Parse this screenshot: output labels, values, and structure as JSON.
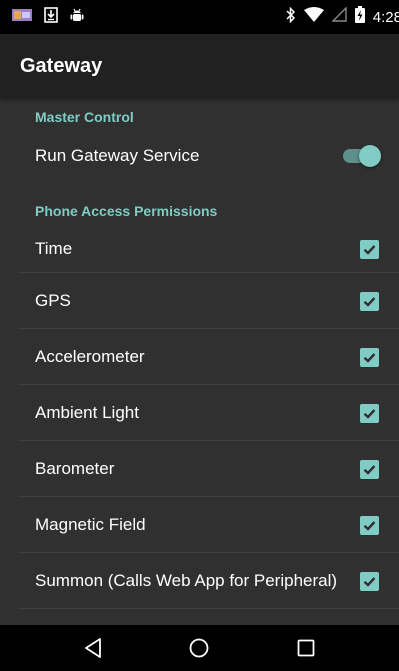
{
  "status_bar": {
    "time": "4:28",
    "icons": [
      "picture-notification-icon",
      "download-icon",
      "android-debug-icon",
      "bluetooth-icon",
      "wifi-icon",
      "signal-icon",
      "battery-charging-icon"
    ]
  },
  "app_bar": {
    "title": "Gateway"
  },
  "master_control": {
    "header": "Master Control",
    "run_service_label": "Run Gateway Service",
    "run_service_on": true
  },
  "permissions": {
    "header": "Phone Access Permissions",
    "items": [
      {
        "label": "Time",
        "checked": true
      },
      {
        "label": "GPS",
        "checked": true
      },
      {
        "label": "Accelerometer",
        "checked": true
      },
      {
        "label": "Ambient Light",
        "checked": true
      },
      {
        "label": "Barometer",
        "checked": true
      },
      {
        "label": "Magnetic Field",
        "checked": true
      },
      {
        "label": "Summon (Calls Web App for Peripheral)",
        "checked": true
      }
    ]
  },
  "nav_bar": {
    "buttons": [
      "back-icon",
      "home-icon",
      "recents-icon"
    ]
  },
  "colors": {
    "accent": "#80cbc4",
    "background": "#303030",
    "app_bar": "#212121"
  }
}
